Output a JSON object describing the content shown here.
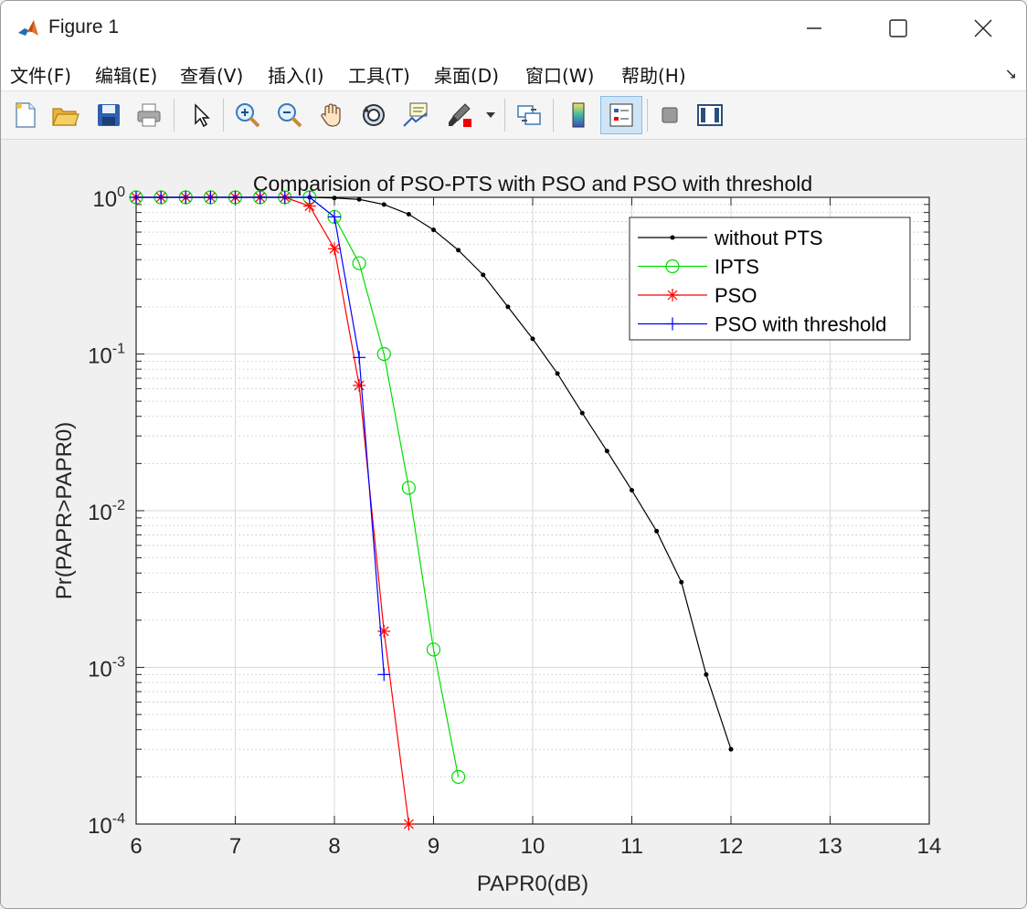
{
  "window": {
    "title": "Figure 1"
  },
  "menu": [
    "文件(F)",
    "编辑(E)",
    "查看(V)",
    "插入(I)",
    "工具(T)",
    "桌面(D)",
    "窗口(W)",
    "帮助(H)"
  ],
  "toolbar": [
    {
      "name": "new-figure-icon"
    },
    {
      "name": "open-file-icon"
    },
    {
      "name": "save-icon"
    },
    {
      "name": "print-icon"
    },
    {
      "name": "pointer-icon"
    },
    {
      "name": "zoom-in-icon"
    },
    {
      "name": "zoom-out-icon"
    },
    {
      "name": "pan-hand-icon"
    },
    {
      "name": "rotate-3d-icon"
    },
    {
      "name": "data-cursor-icon"
    },
    {
      "name": "brush-icon"
    },
    {
      "name": "link-plot-icon"
    },
    {
      "name": "colorbar-icon"
    },
    {
      "name": "legend-icon"
    },
    {
      "name": "hide-plot-tools-icon"
    },
    {
      "name": "show-plot-tools-icon"
    }
  ],
  "chart_data": {
    "type": "line",
    "title": "Comparision of PSO-PTS with PSO and PSO with threshold",
    "xlabel": "PAPR0(dB)",
    "ylabel": "Pr(PAPR>PAPR0)",
    "xlim": [
      6,
      14
    ],
    "ylim": [
      0.0001,
      1
    ],
    "yscale": "log",
    "grid": true,
    "minor_grid": true,
    "legend_position": "top-right",
    "xticks": [
      "6",
      "7",
      "8",
      "9",
      "10",
      "11",
      "12",
      "13",
      "14"
    ],
    "yticks": [
      {
        "base": "10",
        "exp": "0"
      },
      {
        "base": "10",
        "exp": "-1"
      },
      {
        "base": "10",
        "exp": "-2"
      },
      {
        "base": "10",
        "exp": "-3"
      },
      {
        "base": "10",
        "exp": "-4"
      }
    ],
    "series": [
      {
        "name": "without PTS",
        "color": "#000000",
        "marker": "dot",
        "x": [
          6,
          6.25,
          6.5,
          6.75,
          7,
          7.25,
          7.5,
          7.75,
          8,
          8.25,
          8.5,
          8.75,
          9,
          9.25,
          9.5,
          9.75,
          10,
          10.25,
          10.5,
          10.75,
          11,
          11.25,
          11.5,
          11.75,
          12
        ],
        "y": [
          1,
          1,
          1,
          1,
          1,
          1,
          1,
          1,
          0.99,
          0.97,
          0.9,
          0.78,
          0.62,
          0.46,
          0.32,
          0.2,
          0.125,
          0.075,
          0.042,
          0.024,
          0.0135,
          0.0074,
          0.0035,
          0.0009,
          0.0003
        ]
      },
      {
        "name": "IPTS",
        "color": "#00dd00",
        "marker": "circle",
        "x": [
          6,
          6.25,
          6.5,
          6.75,
          7,
          7.25,
          7.5,
          7.75,
          8,
          8.25,
          8.5,
          8.75,
          9,
          9.25
        ],
        "y": [
          1,
          1,
          1,
          1,
          1,
          1,
          1,
          1,
          0.75,
          0.38,
          0.1,
          0.014,
          0.0013,
          0.0002
        ]
      },
      {
        "name": "PSO",
        "color": "#ff0000",
        "marker": "star",
        "x": [
          6,
          6.25,
          6.5,
          6.75,
          7,
          7.25,
          7.5,
          7.75,
          8,
          8.25,
          8.5,
          8.75
        ],
        "y": [
          1,
          1,
          1,
          1,
          1,
          1,
          1,
          0.88,
          0.47,
          0.063,
          0.0017,
          0.0001
        ]
      },
      {
        "name": "PSO with threshold",
        "color": "#0000ff",
        "marker": "plus",
        "x": [
          6,
          6.25,
          6.5,
          6.75,
          7,
          7.25,
          7.5,
          7.75,
          8,
          8.25,
          8.5
        ],
        "y": [
          1,
          1,
          1,
          1,
          1,
          1,
          1,
          1,
          0.75,
          0.095,
          0.0009
        ]
      }
    ]
  }
}
